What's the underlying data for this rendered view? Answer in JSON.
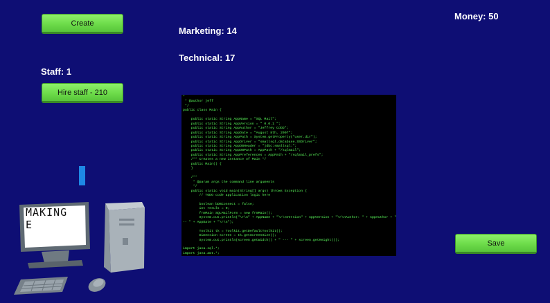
{
  "buttons": {
    "create": "Create",
    "hire": "Hire staff - 210",
    "save": "Save"
  },
  "stats": {
    "marketing": "Marketing: 14",
    "technical": "Technical: 17",
    "money": "Money: 50",
    "staff": "Staff: 1"
  },
  "monitor": {
    "text": "MAKING E"
  },
  "code_lines": [
    "*",
    " * @author jeff",
    " */",
    "public class Main {",
    "",
    "    public static String AppName = \"SQL Mail\";",
    "    public static String AppVersion = \" 0.0.1 \";",
    "    public static String AppAuthor = \"Jeffrey Cobb\";",
    "    public static String AppDate = \"August 8th, 2007\";",
    "    public static String AppPath = System.getProperty(\"user.dir\");",
    "    public static String AppDriver = \"smallsql.database.SSDriver\";",
    "    public static String AppDBHeader = \"jdbc:smallsql:\";",
    "    public static String AppDBPath = AppPath + \"/sqlmail\";",
    "    public static String AppPreferences = AppPath + \"/sqlmail_prefs\";",
    "    /** Creates a new instance of Main */",
    "    public Main() {",
    "    }",
    "",
    "    /**",
    "     * @param args the command line arguments",
    "     */",
    "    public static void main(String[] args) throws Exception {",
    "        // TODO code application logic here",
    "",
    "        boolean bDBConnect = false;",
    "        int result = 0;",
    "        frmMain SQLMailForm = new frmMain();",
    "        System.out.println(\"\\r\\n\" + AppName + \"\\r\\nVersion\" + AppVersion + \"\\r\\nAuthor: \" + AppAuthor + \"",
    "-- \" + AppDate + \"\\r\\n\");",
    "",
    "        Toolkit tk = Toolkit.getDefaultToolkit();",
    "        Dimension screen = tk.getScreenSize();",
    "        System.out.println(screen.getWidth() + \" --- \" + screen.getHeight());",
    "",
    "import java.sql.*;",
    "import java.awt.*;",
    "",
    "/**"
  ]
}
